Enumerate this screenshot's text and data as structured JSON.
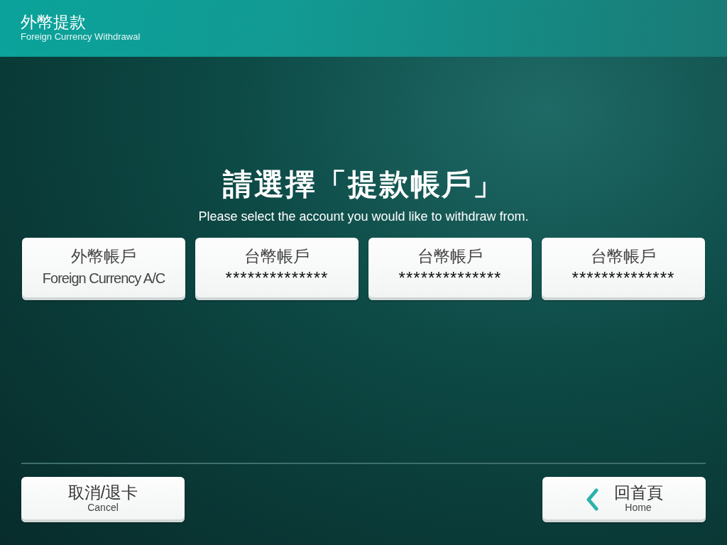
{
  "header": {
    "title": "外幣提款",
    "subtitle": "Foreign Currency Withdrawal"
  },
  "prompt": {
    "title": "請選擇「提款帳戶」",
    "subtitle": "Please select the account you would like to withdraw from."
  },
  "accounts": [
    {
      "kind": "foreign",
      "name": "外幣帳戶",
      "detail": "Foreign Currency A/C"
    },
    {
      "kind": "masked",
      "name": "台幣帳戶",
      "detail": "**************"
    },
    {
      "kind": "masked",
      "name": "台幣帳戶",
      "detail": "**************"
    },
    {
      "kind": "masked",
      "name": "台幣帳戶",
      "detail": "**************"
    }
  ],
  "footer": {
    "cancel": {
      "label": "取消/退卡",
      "sublabel": "Cancel"
    },
    "home": {
      "label": "回首頁",
      "sublabel": "Home"
    }
  }
}
